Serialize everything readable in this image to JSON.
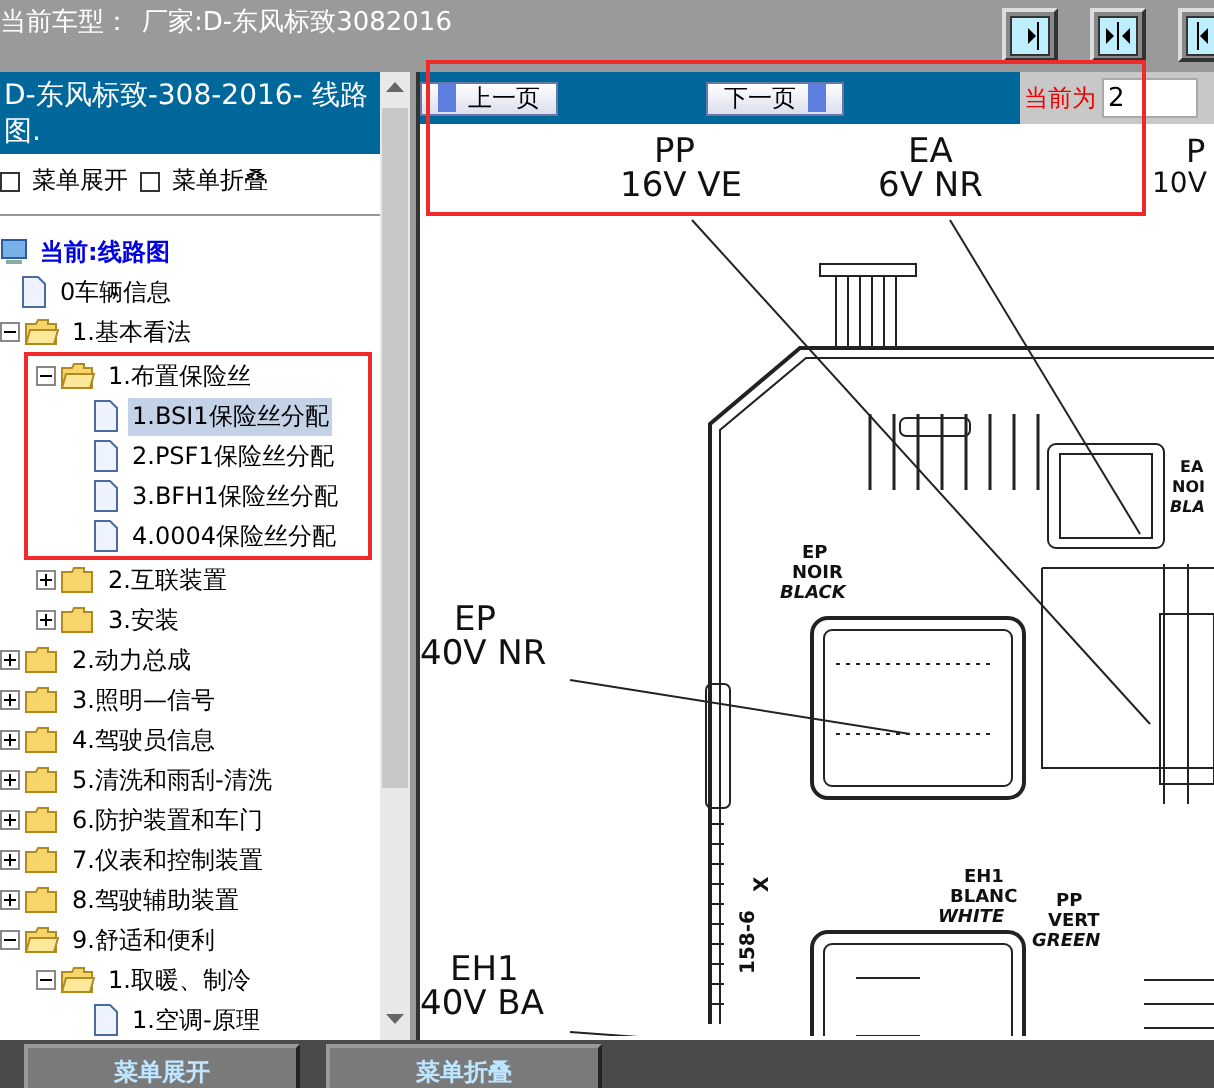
{
  "top_bar": {
    "vehicle_label": "当前车型：",
    "vehicle_value": "厂家:D-东风标致3082016",
    "tool_buttons": [
      {
        "kind": "right"
      },
      {
        "kind": "both"
      },
      {
        "kind": "left"
      }
    ]
  },
  "sidebar": {
    "title": "D-东风标致-308-2016- 线路图.",
    "expand_all": "菜单展开",
    "collapse_all": "菜单折叠",
    "tree": [
      {
        "label": "当前:线路图",
        "kind": "root",
        "selected": false,
        "children": [
          {
            "label": "0车辆信息",
            "kind": "page",
            "selected": false
          },
          {
            "label": "1.基本看法",
            "kind": "folder",
            "expanded": true,
            "selected": false,
            "children": [
              {
                "label": "1.布置保险丝",
                "kind": "folder",
                "expanded": true,
                "selected": false,
                "framed": true,
                "children": [
                  {
                    "label": "1.BSI1保险丝分配",
                    "kind": "page",
                    "selected": true
                  },
                  {
                    "label": "2.PSF1保险丝分配",
                    "kind": "page",
                    "selected": false
                  },
                  {
                    "label": "3.BFH1保险丝分配",
                    "kind": "page",
                    "selected": false
                  },
                  {
                    "label": "4.0004保险丝分配",
                    "kind": "page",
                    "selected": false
                  }
                ]
              },
              {
                "label": "2.互联装置",
                "kind": "folder",
                "expanded": false,
                "selected": false
              },
              {
                "label": "3.安装",
                "kind": "folder",
                "expanded": false,
                "selected": false
              }
            ]
          },
          {
            "label": "2.动力总成",
            "kind": "folder",
            "expanded": false,
            "selected": false
          },
          {
            "label": "3.照明—信号",
            "kind": "folder",
            "expanded": false,
            "selected": false
          },
          {
            "label": "4.驾驶员信息",
            "kind": "folder",
            "expanded": false,
            "selected": false
          },
          {
            "label": "5.清洗和雨刮-清洗",
            "kind": "folder",
            "expanded": false,
            "selected": false
          },
          {
            "label": "6.防护装置和车门",
            "kind": "folder",
            "expanded": false,
            "selected": false
          },
          {
            "label": "7.仪表和控制装置",
            "kind": "folder",
            "expanded": false,
            "selected": false
          },
          {
            "label": "8.驾驶辅助装置",
            "kind": "folder",
            "expanded": false,
            "selected": false
          },
          {
            "label": "9.舒适和便利",
            "kind": "folder",
            "expanded": true,
            "selected": false,
            "children": [
              {
                "label": "1.取暖、制冷",
                "kind": "folder",
                "expanded": true,
                "selected": false,
                "children": [
                  {
                    "label": "1.空调-原理",
                    "kind": "page",
                    "selected": false
                  }
                ]
              }
            ]
          }
        ]
      }
    ]
  },
  "pager": {
    "framed": true,
    "previous": "上一页",
    "next": "下一页",
    "current_label": "当前为",
    "current_value": "2"
  },
  "diagram": {
    "labels": [
      "PP",
      "16V VE",
      "EA",
      "6V NR",
      "P",
      "10V",
      "EA",
      "NOI",
      "BLA",
      "EP",
      "NOIR",
      "BLACK",
      "EP",
      "40V NR",
      "EH1",
      "BLANC",
      "WHITE",
      "PP",
      "VERT",
      "GREEN",
      "X",
      "158-6",
      "EH1",
      "40V BA"
    ]
  },
  "bottom_bar": {
    "buttons": [
      "菜单展开",
      "菜单折叠"
    ]
  }
}
